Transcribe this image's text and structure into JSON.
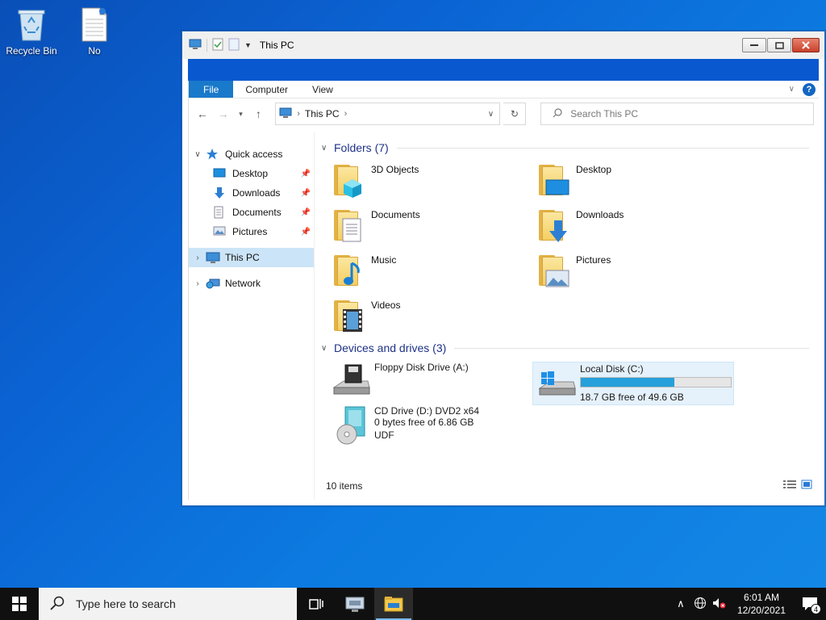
{
  "desktop": {
    "icons": [
      {
        "label": "Recycle Bin"
      },
      {
        "label": "No"
      }
    ]
  },
  "window": {
    "title": "This PC",
    "ribbon_tabs": [
      "File",
      "Computer",
      "View"
    ],
    "help": "?"
  },
  "address": {
    "path": "This PC",
    "search_placeholder": "Search This PC"
  },
  "sidebar": {
    "quick_access": "Quick access",
    "pinned": [
      "Desktop",
      "Downloads",
      "Documents",
      "Pictures"
    ],
    "this_pc": "This PC",
    "network": "Network"
  },
  "content": {
    "folders_header": "Folders (7)",
    "folders": [
      "3D Objects",
      "Desktop",
      "Documents",
      "Downloads",
      "Music",
      "Pictures",
      "Videos"
    ],
    "drives_header": "Devices and drives (3)",
    "drives": [
      {
        "name": "Floppy Disk Drive (A:)",
        "detail": "",
        "detail2": ""
      },
      {
        "name": "Local Disk (C:)",
        "detail": "18.7 GB free of 49.6 GB",
        "detail2": "",
        "used_fraction": 0.623
      },
      {
        "name": "CD Drive (D:) DVD2 x64",
        "detail": "0 bytes free of 6.86 GB",
        "detail2": "UDF"
      }
    ]
  },
  "status": {
    "items": "10 items"
  },
  "taskbar": {
    "search_placeholder": "Type here to search",
    "time": "6:01 AM",
    "date": "12/20/2021",
    "notification_count": "4"
  },
  "colors": {
    "accent": "#1979ca",
    "progress": "#26a0da",
    "header_text": "#1e3287"
  }
}
